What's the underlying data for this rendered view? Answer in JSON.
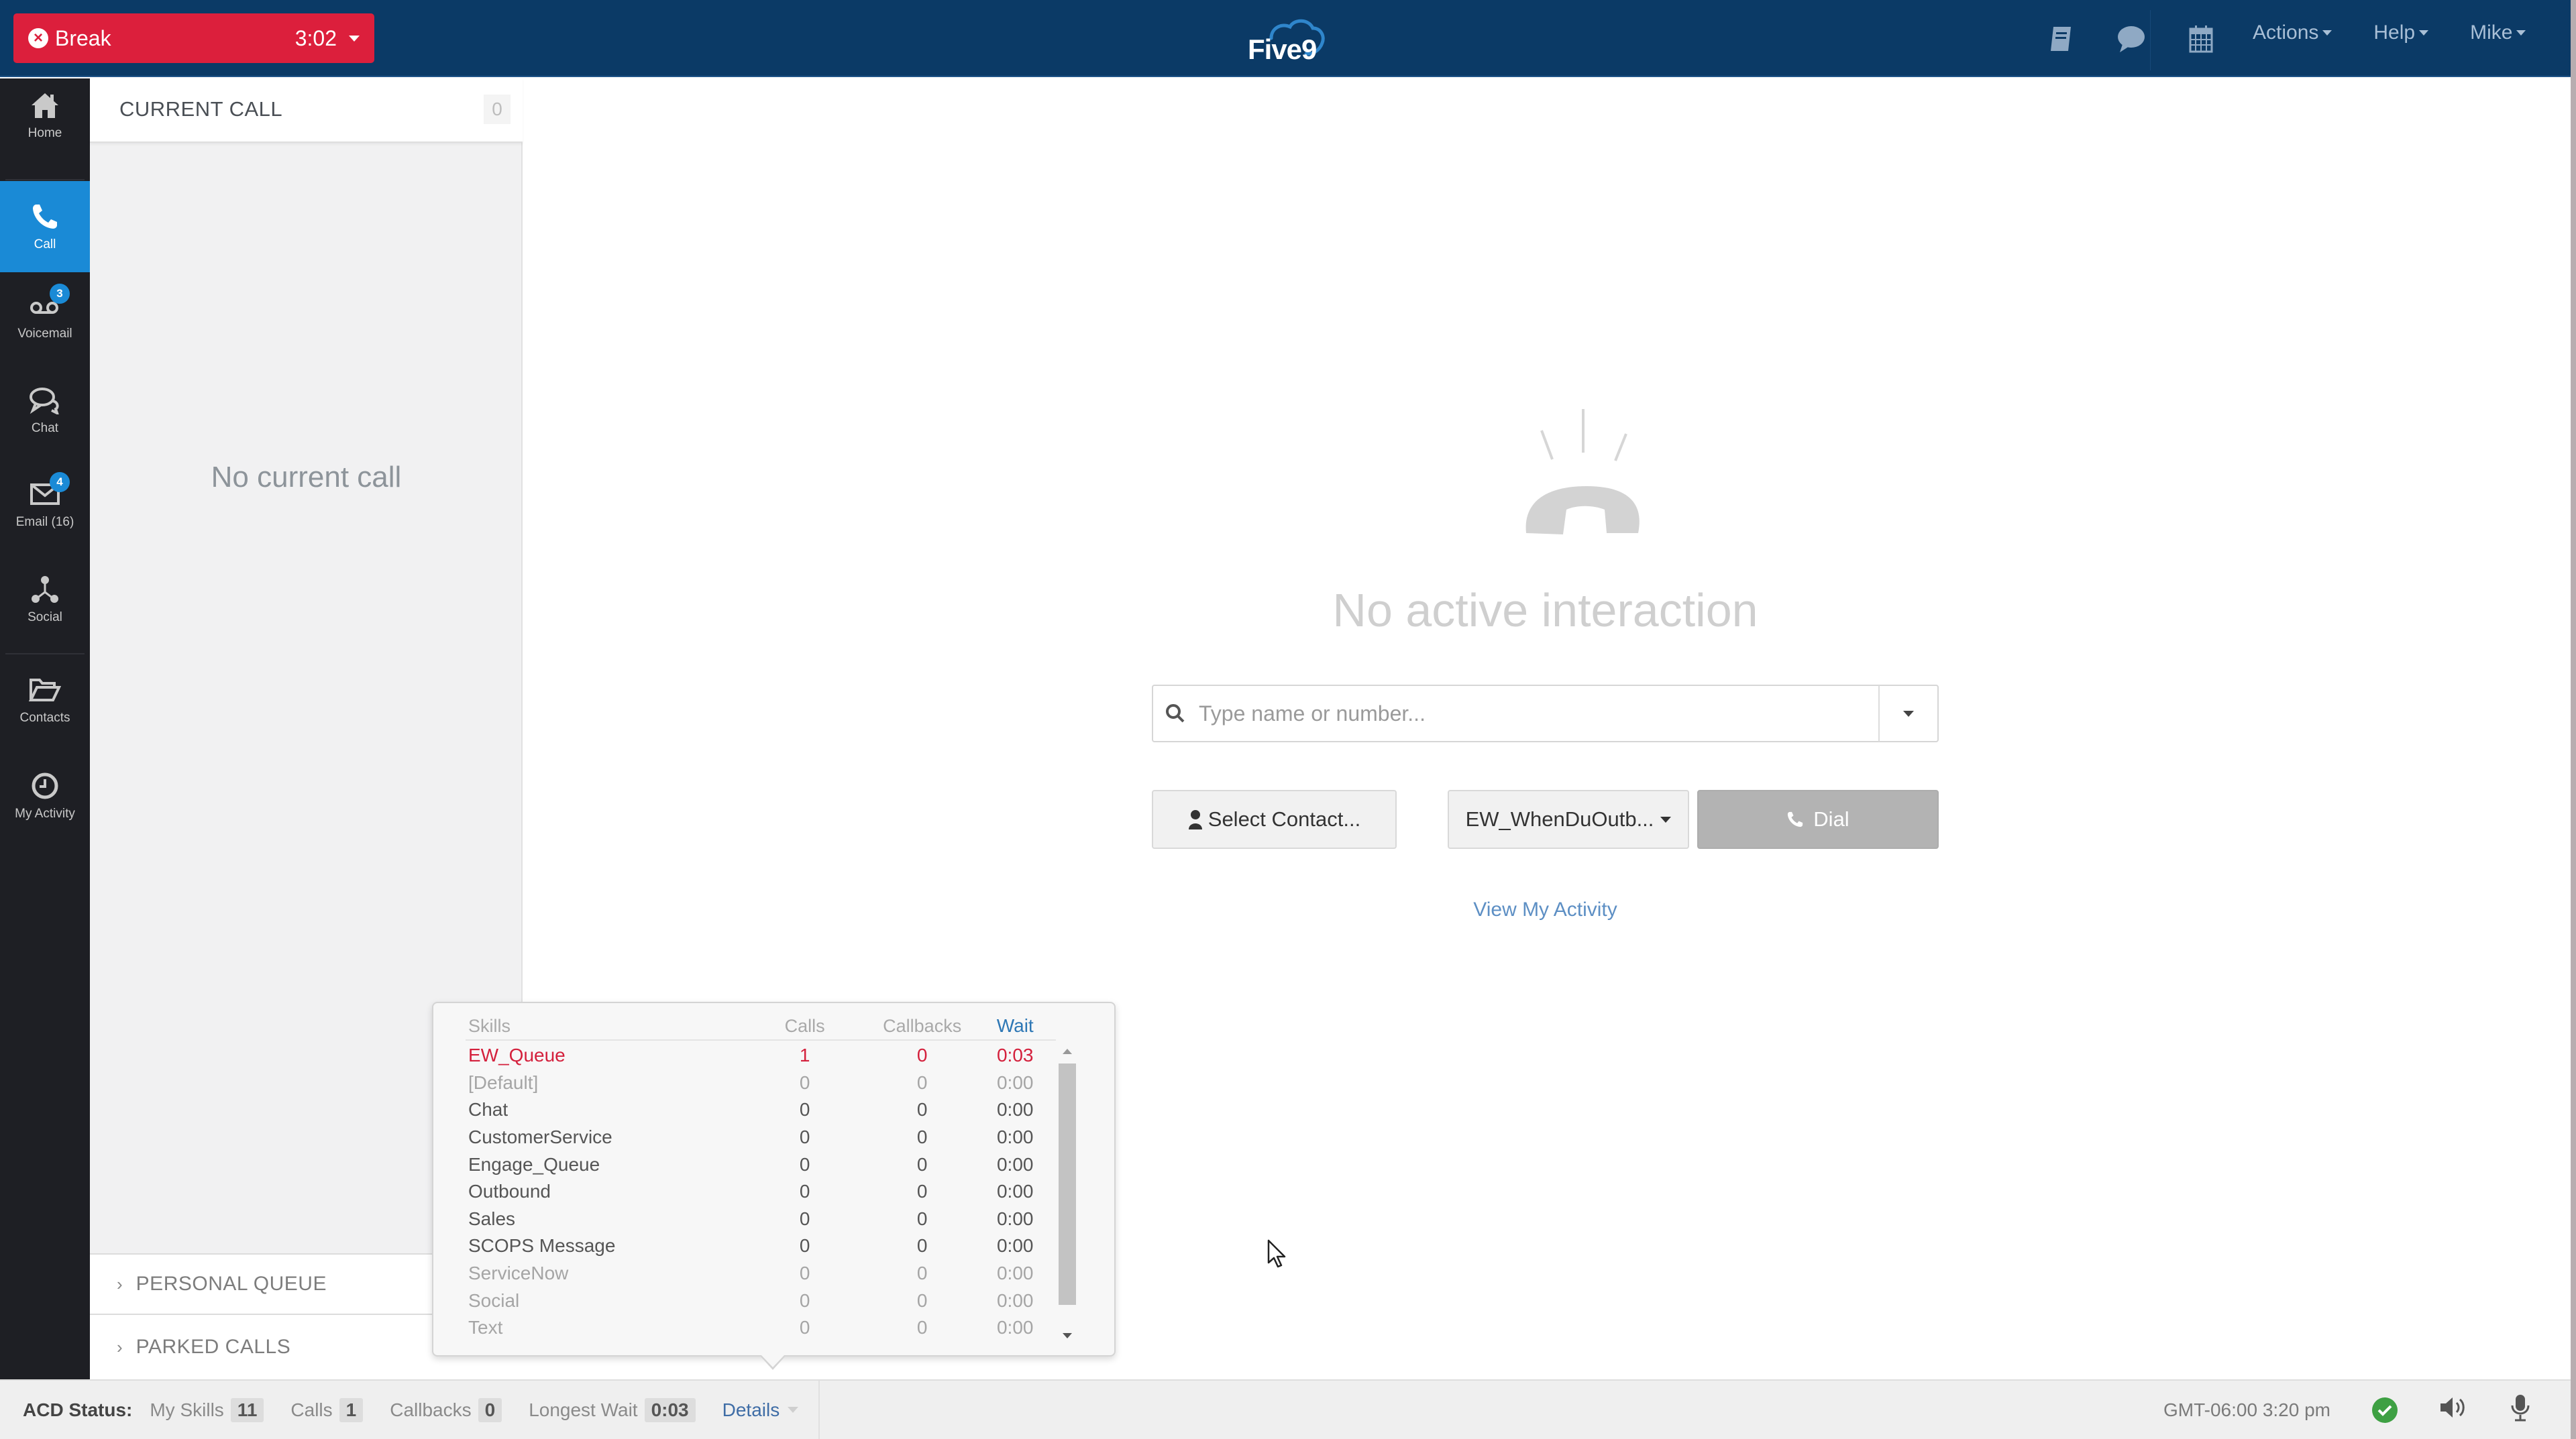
{
  "header": {
    "status_button": {
      "icon": "x-circle-icon",
      "label": "Break",
      "timer": "3:02"
    },
    "logo_text": "Five9",
    "icons": [
      "script-book-icon",
      "chat-bubble-icon",
      "calendar-icon"
    ],
    "menus": [
      {
        "label": "Actions"
      },
      {
        "label": "Help"
      },
      {
        "label": "Mike"
      }
    ]
  },
  "sidebar": {
    "items": [
      {
        "label": "Home",
        "icon": "home-icon",
        "active": false,
        "badge": null
      },
      {
        "label": "Call",
        "icon": "phone-icon",
        "active": true,
        "badge": null
      },
      {
        "label": "Voicemail",
        "icon": "voicemail-icon",
        "active": false,
        "badge": "3"
      },
      {
        "label": "Chat",
        "icon": "chat-icon",
        "active": false,
        "badge": null
      },
      {
        "label": "Email (16)",
        "icon": "envelope-icon",
        "active": false,
        "badge": "4"
      },
      {
        "label": "Social",
        "icon": "social-share-icon",
        "active": false,
        "badge": null
      },
      {
        "label": "Contacts",
        "icon": "folder-open-icon",
        "active": false,
        "badge": null
      },
      {
        "label": "My Activity",
        "icon": "clock-icon",
        "active": false,
        "badge": null
      }
    ]
  },
  "left_panel": {
    "current_call": {
      "title": "CURRENT CALL",
      "count": "0"
    },
    "empty_message": "No current call",
    "sections": [
      {
        "label": "PERSONAL QUEUE"
      },
      {
        "label": "PARKED CALLS"
      }
    ]
  },
  "main": {
    "empty_state": {
      "icon": "hangup-phone-icon",
      "message": "No active interaction"
    },
    "search": {
      "placeholder": "Type name or number...",
      "value": ""
    },
    "select_contact_label": "Select Contact...",
    "campaign_select": {
      "selected": "EW_WhenDuOutb..."
    },
    "dial_label": "Dial",
    "view_activity_label": "View My Activity"
  },
  "skills_popup": {
    "columns": [
      "Skills",
      "Calls",
      "Callbacks",
      "Wait"
    ],
    "rows": [
      {
        "skill": "EW_Queue",
        "calls": "1",
        "callbacks": "0",
        "wait": "0:03",
        "state": "hot"
      },
      {
        "skill": "[Default]",
        "calls": "0",
        "callbacks": "0",
        "wait": "0:00",
        "state": "dim"
      },
      {
        "skill": "Chat",
        "calls": "0",
        "callbacks": "0",
        "wait": "0:00",
        "state": "normal"
      },
      {
        "skill": "CustomerService",
        "calls": "0",
        "callbacks": "0",
        "wait": "0:00",
        "state": "normal"
      },
      {
        "skill": "Engage_Queue",
        "calls": "0",
        "callbacks": "0",
        "wait": "0:00",
        "state": "normal"
      },
      {
        "skill": "Outbound",
        "calls": "0",
        "callbacks": "0",
        "wait": "0:00",
        "state": "normal"
      },
      {
        "skill": "Sales",
        "calls": "0",
        "callbacks": "0",
        "wait": "0:00",
        "state": "normal"
      },
      {
        "skill": "SCOPS Message",
        "calls": "0",
        "callbacks": "0",
        "wait": "0:00",
        "state": "normal"
      },
      {
        "skill": "ServiceNow",
        "calls": "0",
        "callbacks": "0",
        "wait": "0:00",
        "state": "dim"
      },
      {
        "skill": "Social",
        "calls": "0",
        "callbacks": "0",
        "wait": "0:00",
        "state": "dim"
      },
      {
        "skill": "Text",
        "calls": "0",
        "callbacks": "0",
        "wait": "0:00",
        "state": "dim"
      }
    ]
  },
  "status_bar": {
    "title": "ACD Status:",
    "stats": [
      {
        "label": "My Skills",
        "value": "11"
      },
      {
        "label": "Calls",
        "value": "1"
      },
      {
        "label": "Callbacks",
        "value": "0"
      },
      {
        "label": "Longest Wait",
        "value": "0:03"
      }
    ],
    "details_label": "Details",
    "time": "GMT-06:00 3:20 pm",
    "connection_status": "connected",
    "icons": [
      "check-circle-icon",
      "speaker-icon",
      "microphone-icon"
    ]
  },
  "colors": {
    "header_bg": "#0b3a66",
    "break_red": "#dc1f3c",
    "active_blue": "#1a8ad6",
    "sidebar_bg": "#1e1f24",
    "hot_skill": "#d4203c",
    "link_blue": "#3f6da6",
    "ok_green": "#3ea043"
  }
}
